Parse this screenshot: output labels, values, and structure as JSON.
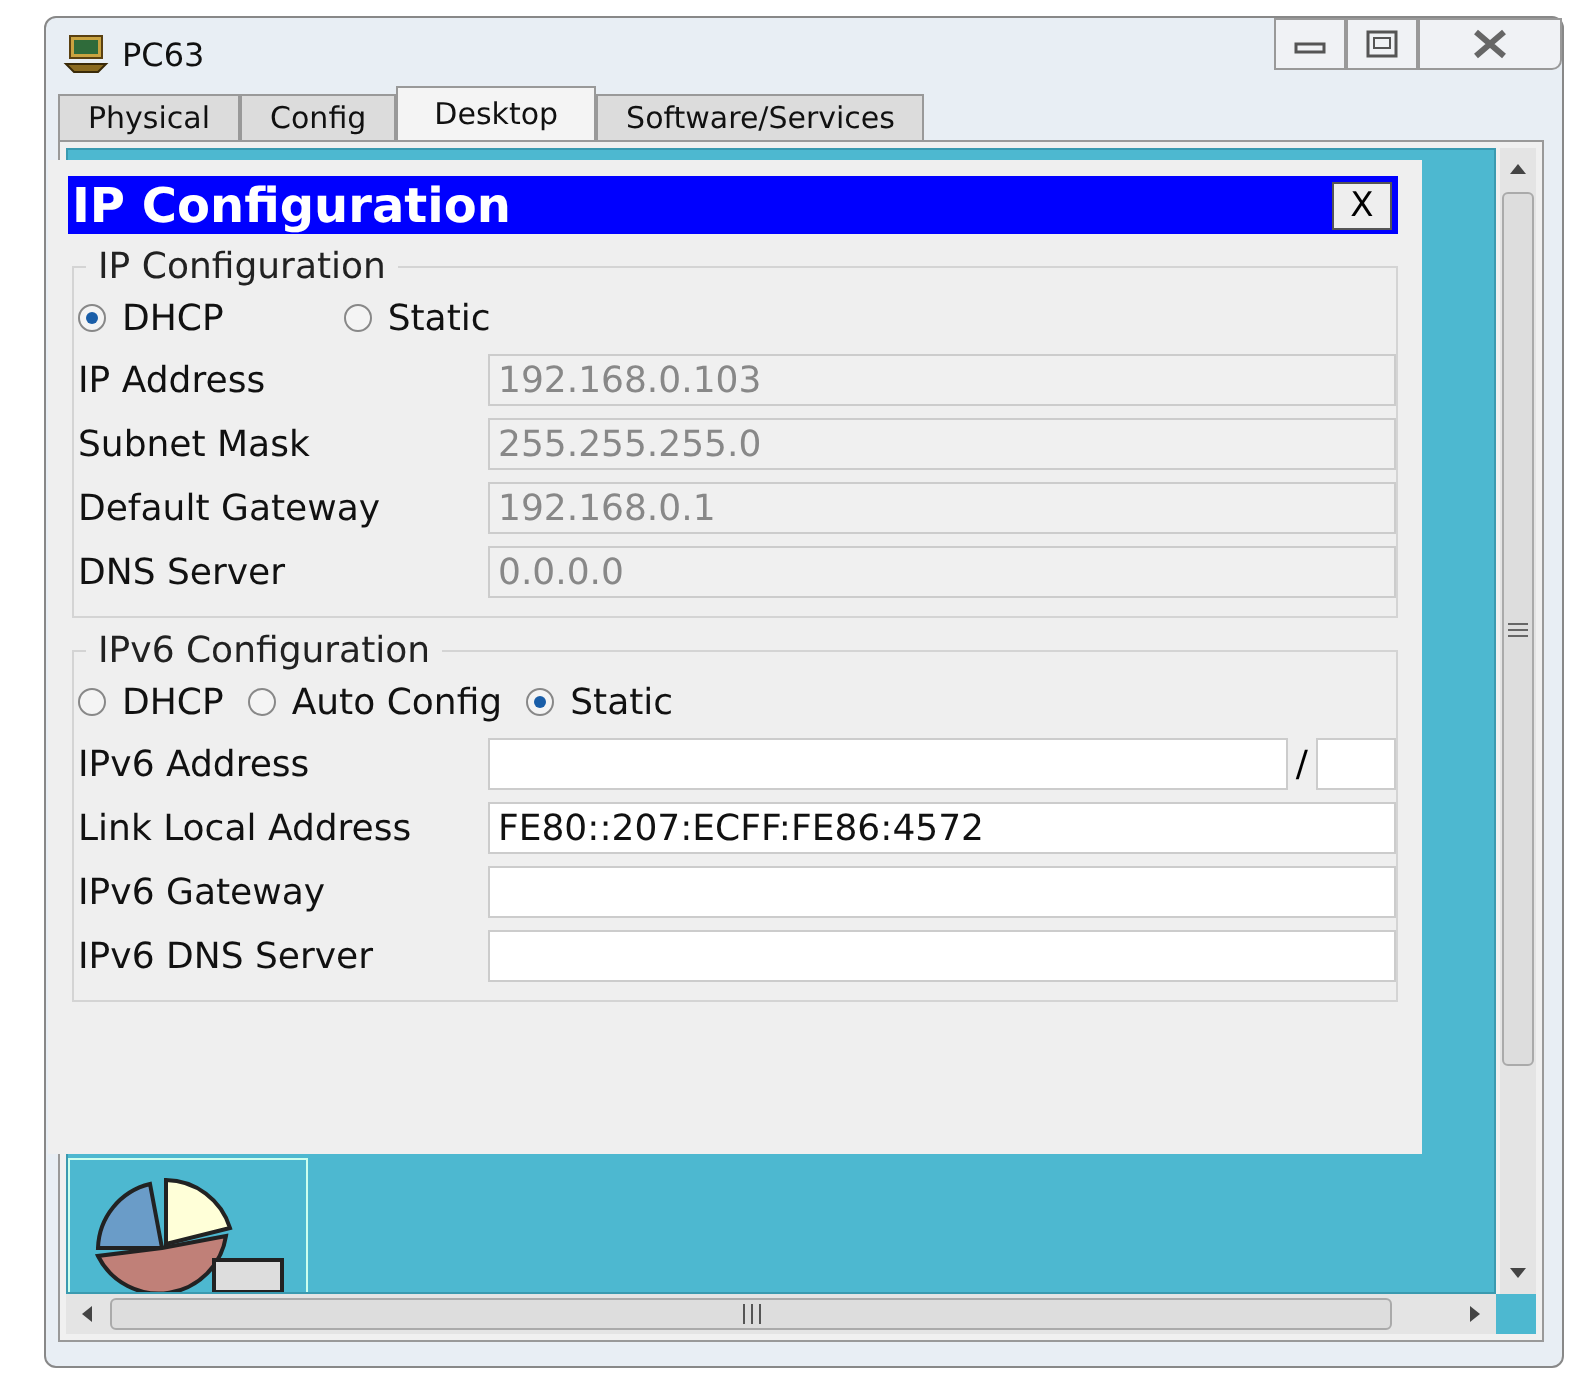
{
  "window": {
    "title": "PC63"
  },
  "tabs": [
    {
      "label": "Physical",
      "selected": false
    },
    {
      "label": "Config",
      "selected": false
    },
    {
      "label": "Desktop",
      "selected": true
    },
    {
      "label": "Software/Services",
      "selected": false
    }
  ],
  "dialog": {
    "title": "IP Configuration",
    "close": "X",
    "ipv4": {
      "legend": "IP Configuration",
      "modes": [
        {
          "label": "DHCP",
          "selected": true
        },
        {
          "label": "Static",
          "selected": false
        }
      ],
      "fields": [
        {
          "label": "IP Address",
          "value": "192.168.0.103",
          "disabled": true
        },
        {
          "label": "Subnet Mask",
          "value": "255.255.255.0",
          "disabled": true
        },
        {
          "label": "Default Gateway",
          "value": "192.168.0.1",
          "disabled": true
        },
        {
          "label": "DNS Server",
          "value": "0.0.0.0",
          "disabled": true
        }
      ]
    },
    "ipv6": {
      "legend": "IPv6 Configuration",
      "modes": [
        {
          "label": "DHCP",
          "selected": false
        },
        {
          "label": "Auto Config",
          "selected": false
        },
        {
          "label": "Static",
          "selected": true
        }
      ],
      "fields": [
        {
          "label": "IPv6 Address",
          "disabled": false,
          "separator": "/"
        },
        {
          "label": "Link Local Address",
          "value": "FE80::207:ECFF:FE86:4572",
          "disabled": false
        },
        {
          "label": "IPv6 Gateway",
          "disabled": false
        },
        {
          "label": "IPv6 DNS Server",
          "disabled": false
        }
      ]
    }
  }
}
